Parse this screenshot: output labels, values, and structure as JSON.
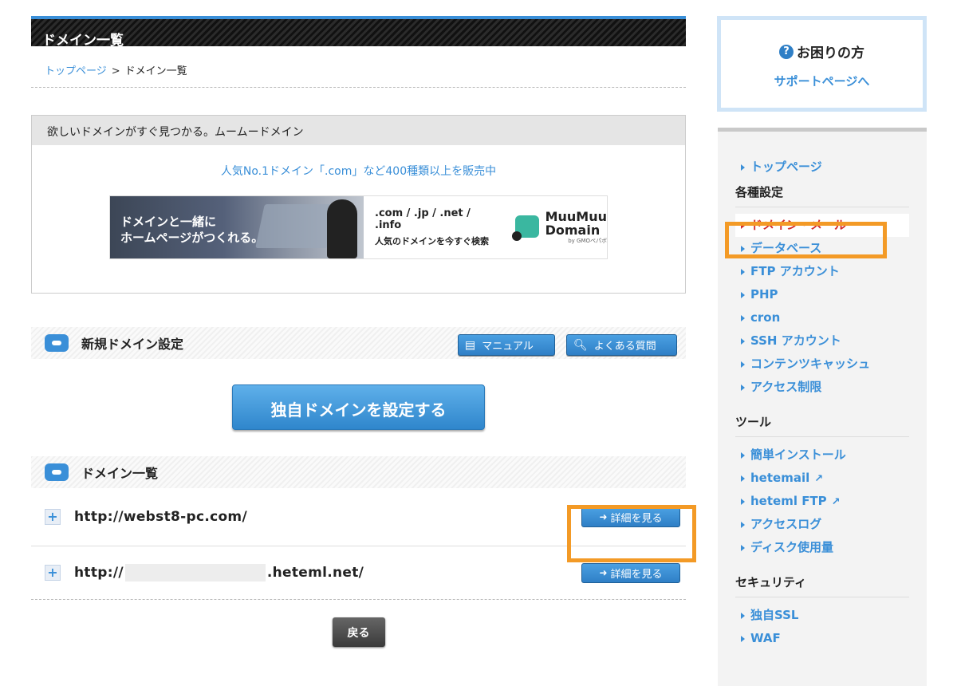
{
  "page": {
    "title": "ドメイン一覧"
  },
  "breadcrumb": {
    "home": "トップページ",
    "separator": ">",
    "current": "ドメイン一覧"
  },
  "promo": {
    "heading": "欲しいドメインがすぐ見つかる。ムームードメイン",
    "link_text": "人気No.1ドメイン「.com」など400種類以上を販売中",
    "banner_left_line1": "ドメインと一緒に",
    "banner_left_line2": "ホームページがつくれる。",
    "banner_tlds": ".com / .jp / .net / .info",
    "banner_sub": "人気のドメインを今すぐ検索",
    "logo_line1": "MuuMuu",
    "logo_line2": "Domain",
    "logo_by": "by GMOペパボ"
  },
  "new_domain": {
    "title": "新規ドメイン設定",
    "manual_label": "マニュアル",
    "faq_label": "よくある質問",
    "setup_button": "独自ドメインを設定する"
  },
  "domain_list": {
    "title": "ドメイン一覧",
    "detail_label": "詳細を見る",
    "rows": [
      {
        "url_prefix": "http://webst8-pc.com/",
        "url_suffix": ""
      },
      {
        "url_prefix": "http://",
        "url_suffix": ".heteml.net/"
      }
    ]
  },
  "back_button": "戻る",
  "help": {
    "title": "お困りの方",
    "link": "サポートページへ"
  },
  "sidebar": {
    "top": "トップページ",
    "group_settings": "各種設定",
    "settings": [
      "ドメイン・メール",
      "データベース",
      "FTP アカウント",
      "PHP",
      "cron",
      "SSH アカウント",
      "コンテンツキャッシュ",
      "アクセス制限"
    ],
    "group_tools": "ツール",
    "tools": [
      "簡単インストール",
      "hetemail",
      "heteml FTP",
      "アクセスログ",
      "ディスク使用量"
    ],
    "group_security": "セキュリティ",
    "security": [
      "独自SSL",
      "WAF"
    ]
  },
  "colors": {
    "accent": "#3a8fd8",
    "highlight": "#f39a26",
    "active": "#d32d2d"
  }
}
